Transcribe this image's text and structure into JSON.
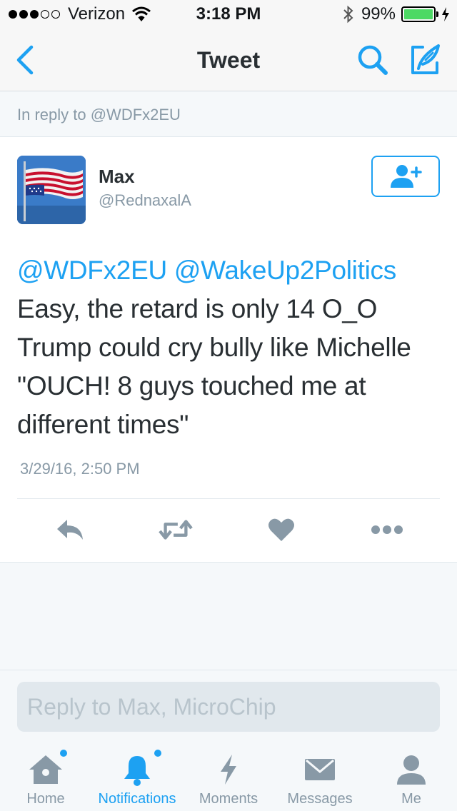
{
  "status_bar": {
    "carrier": "Verizon",
    "time": "3:18 PM",
    "battery": "99%",
    "battery_level": 0.99,
    "battery_color": "#4cd964"
  },
  "nav": {
    "title": "Tweet",
    "back_icon": "chevron-left-icon",
    "search_icon": "search-icon",
    "compose_icon": "compose-tweet-icon"
  },
  "reply_context": "In reply to @WDFx2EU",
  "tweet": {
    "user_name": "Max",
    "user_handle": "@RednaxalA",
    "avatar": "upside-down-us-flag-avatar",
    "follow_icon": "add-user-icon",
    "mentions": "@WDFx2EU @WakeUp2Politics",
    "body": "Easy, the retard is only 14 O_O Trump could cry bully like Michelle \"OUCH! 8 guys touched me at different times\"",
    "date": "3/29/16, 2:50 PM",
    "actions": [
      "reply-icon",
      "retweet-icon",
      "like-icon",
      "more-icon"
    ]
  },
  "reply_input": {
    "placeholder": "Reply to Max, MicroChip",
    "value": ""
  },
  "tabs": [
    {
      "label": "Home",
      "icon": "home-icon",
      "active": false,
      "has_dot": true
    },
    {
      "label": "Notifications",
      "icon": "bell-icon",
      "active": true,
      "has_dot": true
    },
    {
      "label": "Moments",
      "icon": "lightning-icon",
      "active": false,
      "has_dot": false
    },
    {
      "label": "Messages",
      "icon": "envelope-icon",
      "active": false,
      "has_dot": false
    },
    {
      "label": "Me",
      "icon": "person-icon",
      "active": false,
      "has_dot": false
    }
  ],
  "colors": {
    "accent": "#1da1f2",
    "icon_gray": "#8899a6",
    "text": "#292f33"
  }
}
